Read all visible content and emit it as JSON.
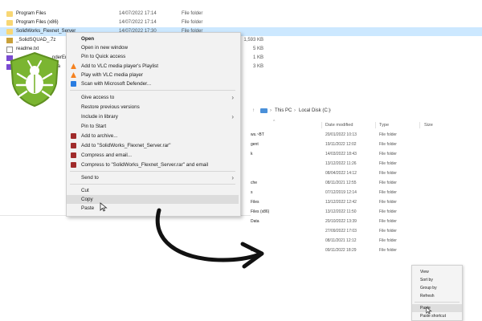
{
  "top_files": [
    {
      "name": "Program Files",
      "date": "14/07/2022 17:14",
      "type": "File folder",
      "size": "",
      "icon": "folder-icon"
    },
    {
      "name": "Program Files (x86)",
      "date": "14/07/2022 17:14",
      "type": "File folder",
      "size": "",
      "icon": "folder-icon"
    },
    {
      "name": "SolidWorks_Flexnet_Server",
      "date": "14/07/2022 17:30",
      "type": "File folder",
      "size": "",
      "icon": "folder-icon",
      "selected": true
    },
    {
      "name": "_SolidSQUAD_.7z",
      "date": "",
      "type": "",
      "size": "1,593 KB",
      "icon": "zip-icon"
    },
    {
      "name": "readme.txt",
      "date": "",
      "type": "",
      "size": "5 KB",
      "icon": "txt-icon"
    },
    {
      "name": "...nderEn",
      "date": "",
      "type": "",
      "size": "1 KB",
      "icon": "rar-icon"
    },
    {
      "name": "...eria",
      "date": "",
      "type": "",
      "size": "3 KB",
      "icon": "rar-icon"
    }
  ],
  "context_menu": {
    "items": [
      {
        "label": "Open",
        "bold": true
      },
      {
        "label": "Open in new window"
      },
      {
        "label": "Pin to Quick access"
      },
      {
        "label": "Add to VLC media player's Playlist",
        "icon": "vlc-icon"
      },
      {
        "label": "Play with VLC media player",
        "icon": "vlc-icon"
      },
      {
        "label": "Scan with Microsoft Defender...",
        "icon": "defender-icon"
      },
      {
        "label": "Give access to",
        "submenu": true
      },
      {
        "label": "Restore previous versions"
      },
      {
        "label": "Include in library",
        "submenu": true
      },
      {
        "label": "Pin to Start"
      },
      {
        "label": "Add to archive...",
        "icon": "winrar-icon"
      },
      {
        "label": "Add to \"SolidWorks_Flexnet_Server.rar\"",
        "icon": "winrar-icon"
      },
      {
        "label": "Compress and email...",
        "icon": "winrar-icon"
      },
      {
        "label": "Compress to \"SolidWorks_Flexnet_Server.rar\" and email",
        "icon": "winrar-icon"
      },
      {
        "label": "Send to",
        "submenu": true
      },
      {
        "label": "Cut"
      },
      {
        "label": "Copy",
        "hover": true
      },
      {
        "label": "Paste"
      }
    ],
    "submenu_arrow": "›"
  },
  "explorer2": {
    "breadcrumb": [
      "This PC",
      "Local Disk (C:)"
    ],
    "breadcrumb_sep": "›",
    "columns": {
      "date": "Date modified",
      "type": "Type",
      "size": "Size"
    },
    "rows": [
      {
        "name": "ws.~BT",
        "date": "20/01/2022 10:13",
        "type": "File folder"
      },
      {
        "name": "gent",
        "date": "19/11/2022 12:02",
        "type": "File folder"
      },
      {
        "name": "k",
        "date": "14/03/2022 18:43",
        "type": "File folder"
      },
      {
        "name": "",
        "date": "13/12/2022 11:26",
        "type": "File folder"
      },
      {
        "name": "",
        "date": "08/04/2022 14:12",
        "type": "File folder"
      },
      {
        "name": "che",
        "date": "08/11/2021 12:55",
        "type": "File folder"
      },
      {
        "name": "s",
        "date": "07/12/2019 12:14",
        "type": "File folder"
      },
      {
        "name": "Files",
        "date": "13/12/2022 12:42",
        "type": "File folder"
      },
      {
        "name": "Files (x86)",
        "date": "13/12/2022 11:50",
        "type": "File folder"
      },
      {
        "name": "Data",
        "date": "20/10/2022 13:39",
        "type": "File folder"
      },
      {
        "name": "",
        "date": "27/09/2022 17:03",
        "type": "File folder"
      },
      {
        "name": "",
        "date": "08/11/2021 12:12",
        "type": "File folder"
      },
      {
        "name": "s",
        "date": "09/11/2022 18:29",
        "type": "File folder"
      }
    ]
  },
  "desktop_menu": {
    "items": [
      {
        "label": "View"
      },
      {
        "label": "Sort by"
      },
      {
        "label": "Group by"
      },
      {
        "label": "Refresh"
      },
      {
        "label": "Paste",
        "hover": true
      },
      {
        "label": "Paste shortcut"
      }
    ]
  },
  "colors": {
    "selection": "#cce8ff",
    "menu_bg": "#f2f2f2",
    "defender_green": "#7bb531",
    "arrow": "#111111"
  }
}
